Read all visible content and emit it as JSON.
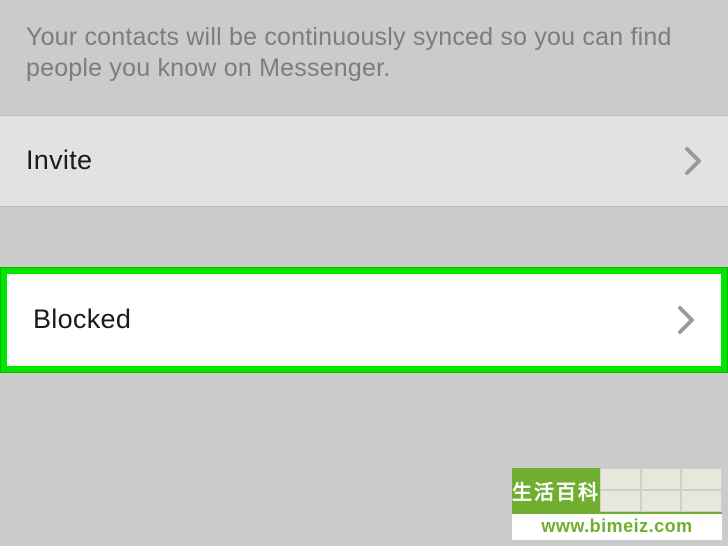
{
  "info": "Your contacts will be continuously synced so you can find people you know on Messenger.",
  "rows": {
    "invite": "Invite",
    "blocked": "Blocked"
  },
  "watermark": {
    "title": "生活百科",
    "url": "www.bimeiz.com"
  }
}
